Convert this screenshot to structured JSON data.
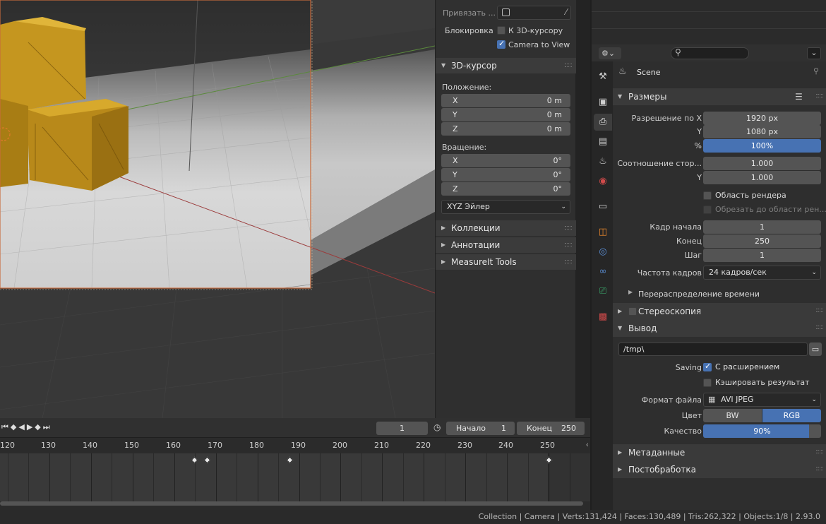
{
  "npanel": {
    "snap_label": "Привязать ...",
    "lock_label": "Блокировка",
    "lock_cursor": "К 3D-курсору",
    "camera_to_view": "Camera to View",
    "cursor_title": "3D-курсор",
    "location_label": "Положение:",
    "location": [
      {
        "k": "X",
        "v": "0 m"
      },
      {
        "k": "Y",
        "v": "0 m"
      },
      {
        "k": "Z",
        "v": "0 m"
      }
    ],
    "rotation_label": "Вращение:",
    "rotation": [
      {
        "k": "X",
        "v": "0°"
      },
      {
        "k": "Y",
        "v": "0°"
      },
      {
        "k": "Z",
        "v": "0°"
      }
    ],
    "rotation_mode": "XYZ Эйлер",
    "collapsed": [
      "Коллекции",
      "Аннотации",
      "MeasureIt Tools"
    ]
  },
  "timeline": {
    "current_frame": "1",
    "start_label": "Начало",
    "start_value": "1",
    "end_label": "Конец",
    "end_value": "250",
    "ticks": [
      "120",
      "130",
      "140",
      "150",
      "160",
      "170",
      "180",
      "190",
      "200",
      "210",
      "220",
      "230",
      "240",
      "250"
    ]
  },
  "status": {
    "text": "Collection | Camera | Verts:131,424 | Faces:130,489 | Tris:262,322 | Objects:1/8 | 2.93.0"
  },
  "props": {
    "scene": "Scene",
    "dims_title": "Размеры",
    "res_x_label": "Разрешение по X",
    "res_x": "1920 px",
    "res_y_label": "Y",
    "res_y": "1080 px",
    "pct_label": "%",
    "pct": "100%",
    "aspect_label": "Соотношение стор...",
    "aspect_x": "1.000",
    "aspect_y_label": "Y",
    "aspect_y": "1.000",
    "render_region": "Область рендера",
    "crop_region": "Обрезать до области рен...",
    "frame_start_label": "Кадр начала",
    "frame_start": "1",
    "frame_end_label": "Конец",
    "frame_end": "250",
    "frame_step_label": "Шаг",
    "frame_step": "1",
    "fps_label": "Частота кадров",
    "fps": "24 кадров/сек",
    "time_remap": "Перераспределение времени",
    "stereo_title": "Стереоскопия",
    "output_title": "Вывод",
    "output_path": "/tmp\\",
    "saving_label": "Saving",
    "file_ext": "С расширением",
    "cache_result": "Кэшировать результат",
    "format_label": "Формат файла",
    "format": "AVI JPEG",
    "color_label": "Цвет",
    "color_bw": "BW",
    "color_rgb": "RGB",
    "quality_label": "Качество",
    "quality": "90%",
    "quality_fraction": 0.9,
    "meta_title": "Метаданные",
    "post_title": "Постобработка"
  }
}
